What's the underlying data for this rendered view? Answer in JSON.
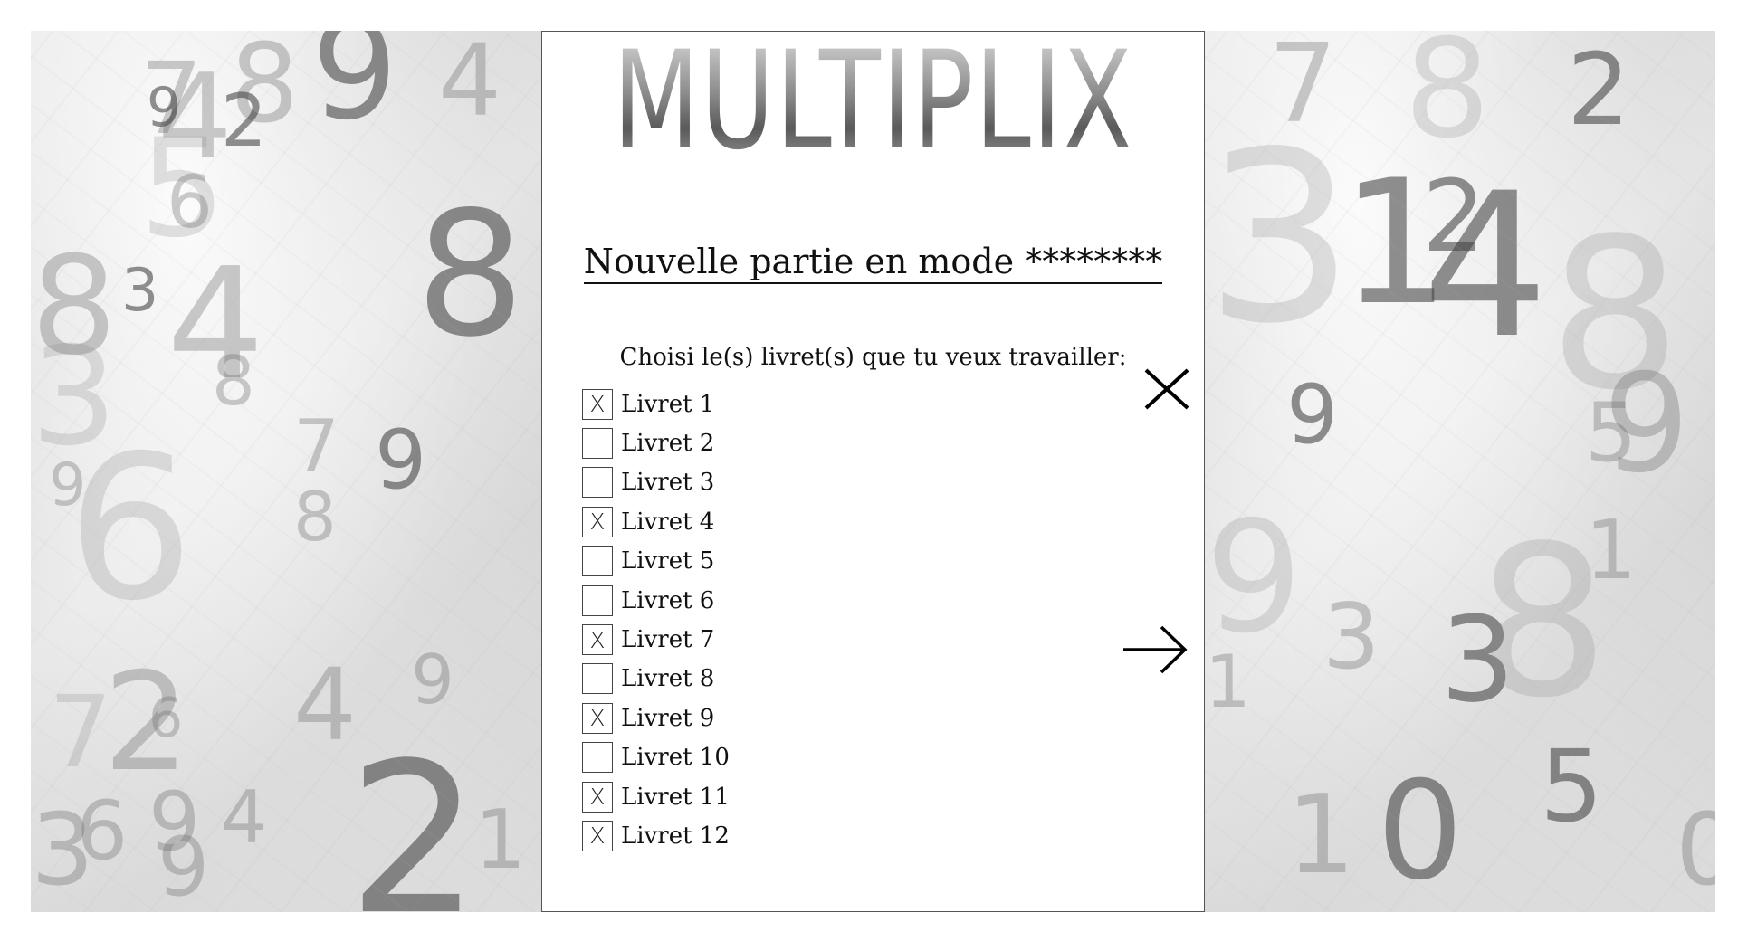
{
  "app": {
    "logo_text": "MULTIPLIX"
  },
  "dialog": {
    "title": "Nouvelle partie en mode ********",
    "subtitle": "Choisi le(s) livret(s) que tu veux travailler:",
    "check_mark": "X",
    "close_icon": "close-icon",
    "next_icon": "arrow-right-icon",
    "items": [
      {
        "label": "Livret 1",
        "checked": true
      },
      {
        "label": "Livret 2",
        "checked": false
      },
      {
        "label": "Livret 3",
        "checked": false
      },
      {
        "label": "Livret 4",
        "checked": true
      },
      {
        "label": "Livret 5",
        "checked": false
      },
      {
        "label": "Livret 6",
        "checked": false
      },
      {
        "label": "Livret 7",
        "checked": true
      },
      {
        "label": "Livret 8",
        "checked": false
      },
      {
        "label": "Livret 9",
        "checked": true
      },
      {
        "label": "Livret 10",
        "checked": false
      },
      {
        "label": "Livret 11",
        "checked": true
      },
      {
        "label": "Livret 12",
        "checked": true
      }
    ]
  },
  "background": {
    "left_digits": [
      "7",
      "8",
      "4",
      "2",
      "9",
      "9",
      "4",
      "3",
      "5",
      "6",
      "8",
      "8",
      "3",
      "4",
      "8",
      "9",
      "7",
      "9",
      "8",
      "6",
      "2",
      "7",
      "9",
      "6",
      "4",
      "4",
      "9",
      "3",
      "6",
      "9",
      "2",
      "1"
    ],
    "right_digits": [
      "7",
      "8",
      "2",
      "1",
      "2",
      "4",
      "8",
      "9",
      "5",
      "9",
      "9",
      "3",
      "3",
      "8",
      "1",
      "1",
      "0",
      "5",
      "0",
      "1",
      "3"
    ]
  }
}
